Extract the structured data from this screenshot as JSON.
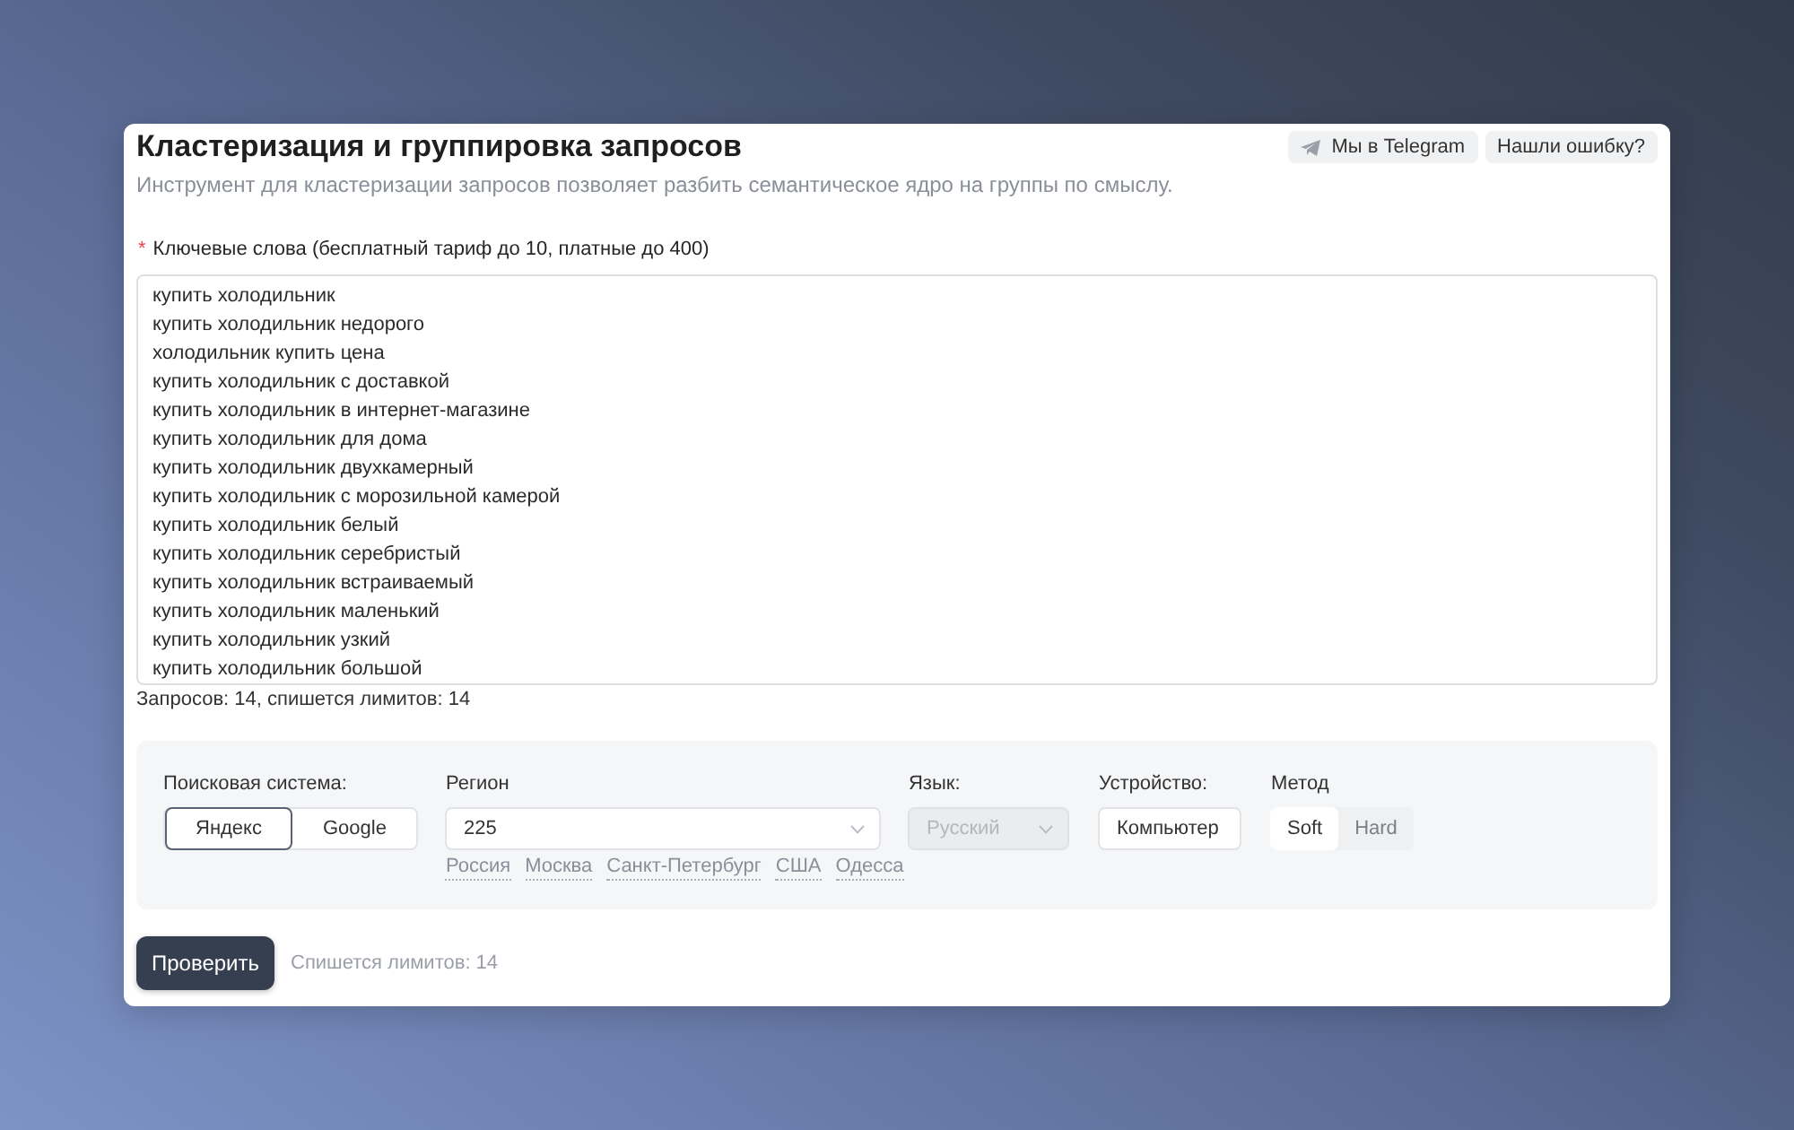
{
  "header": {
    "title": "Кластеризация и группировка запросов",
    "subtitle": "Инструмент для кластеризации запросов позволяет разбить семантическое ядро на группы по смыслу.",
    "buttons": [
      {
        "label": "Мы в Telegram",
        "kind": "telegram"
      },
      {
        "label": "Нашли ошибку?",
        "kind": "plain"
      }
    ]
  },
  "keywords": {
    "required_mark": "*",
    "label": "Ключевые слова (бесплатный тариф до 10, платные до 400)",
    "lines": [
      "купить холодильник",
      "купить холодильник недорого",
      "холодильник купить цена",
      "купить холодильник с доставкой",
      "купить холодильник в интернет-магазине",
      "купить холодильник для дома",
      "купить холодильник двухкамерный",
      "купить холодильник с морозильной камерой",
      "купить холодильник белый",
      "купить холодильник серебристый",
      "купить холодильник встраиваемый",
      "купить холодильник маленький",
      "купить холодильник узкий",
      "купить холодильник большой"
    ],
    "summary": "Запросов: 14, спишется лимитов: 14"
  },
  "settings": {
    "search_engine": {
      "label": "Поисковая система:",
      "options": [
        {
          "label": "Яндекс",
          "selected": true
        },
        {
          "label": "Google",
          "selected": false
        }
      ]
    },
    "region": {
      "label": "Регион",
      "value": "225",
      "quick_links": [
        "Россия",
        "Москва",
        "Санкт-Петербург",
        "США",
        "Одесса"
      ]
    },
    "language": {
      "label": "Язык:",
      "value": "Русский",
      "disabled": true
    },
    "device": {
      "label": "Устройство:",
      "value": "Компьютер",
      "disabled": false
    },
    "method": {
      "label": "Метод",
      "options": [
        {
          "label": "Soft",
          "selected": true
        },
        {
          "label": "Hard",
          "selected": false
        }
      ]
    }
  },
  "submit": {
    "label": "Проверить",
    "note": "Спишется лимитов: 14"
  }
}
